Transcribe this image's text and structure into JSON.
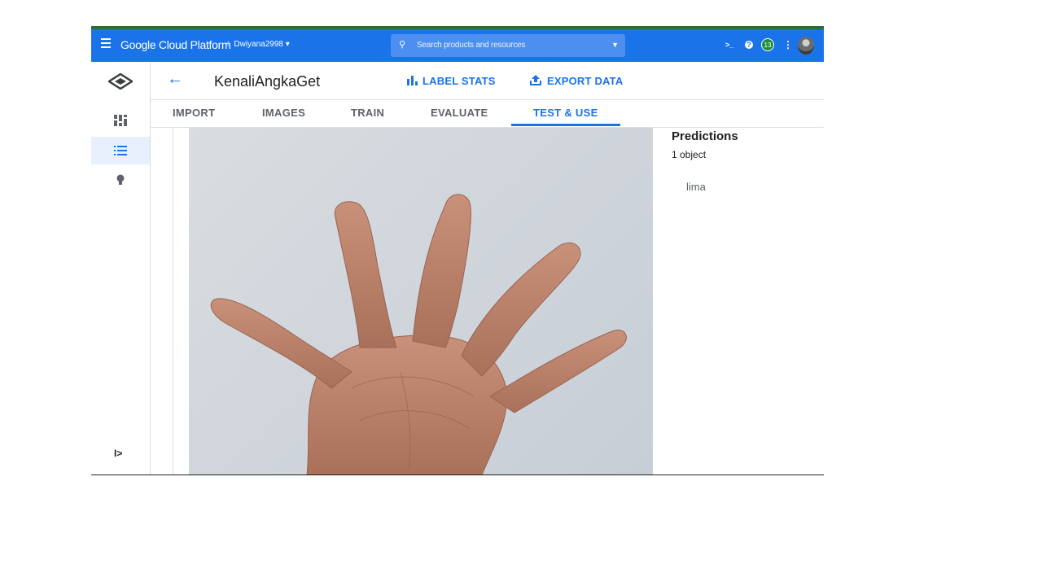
{
  "topbar": {
    "brand": "Google Cloud Platform",
    "project": "Dwiyana2998",
    "search_placeholder": "Search products and resources",
    "notification_count": "13"
  },
  "header": {
    "title": "KenaliAngkaGet",
    "label_stats": "LABEL STATS",
    "export_data": "EXPORT DATA"
  },
  "tabs": [
    "IMPORT",
    "IMAGES",
    "TRAIN",
    "EVALUATE",
    "TEST & USE"
  ],
  "active_tab": "TEST & USE",
  "predictions": {
    "heading": "Predictions",
    "count": "1 object",
    "label": "lima"
  },
  "colors": {
    "topbar": "#1a73e8",
    "accent": "#1a73e8",
    "badge": "#1e8e3e"
  }
}
